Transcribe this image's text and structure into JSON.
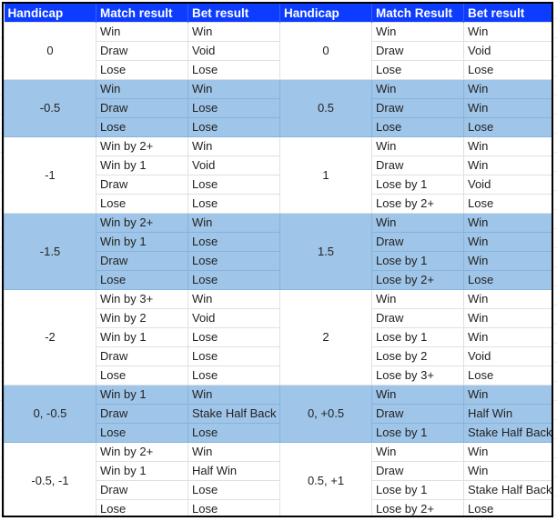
{
  "colors": {
    "header_bg": "#0b3cff",
    "header_text": "#ffffff",
    "band_blue": "#9fc5e8",
    "band_white": "#ffffff"
  },
  "headers": [
    "Handicap",
    "Match result",
    "Bet result",
    "Handicap",
    "Match Result",
    "Bet result"
  ],
  "groups": [
    {
      "shade": "white",
      "left": {
        "handicap": "0",
        "rows": [
          [
            "Win",
            "Win"
          ],
          [
            "Draw",
            "Void"
          ],
          [
            "Lose",
            "Lose"
          ]
        ]
      },
      "right": {
        "handicap": "0",
        "rows": [
          [
            "Win",
            "Win"
          ],
          [
            "Draw",
            "Void"
          ],
          [
            "Lose",
            "Lose"
          ]
        ]
      }
    },
    {
      "shade": "blue",
      "left": {
        "handicap": "-0.5",
        "rows": [
          [
            "Win",
            "Win"
          ],
          [
            "Draw",
            "Lose"
          ],
          [
            "Lose",
            "Lose"
          ]
        ]
      },
      "right": {
        "handicap": "0.5",
        "rows": [
          [
            "Win",
            "Win"
          ],
          [
            "Draw",
            "Win"
          ],
          [
            "Lose",
            "Lose"
          ]
        ]
      }
    },
    {
      "shade": "white",
      "left": {
        "handicap": "-1",
        "rows": [
          [
            "Win by 2+",
            "Win"
          ],
          [
            "Win by 1",
            "Void"
          ],
          [
            "Draw",
            "Lose"
          ],
          [
            "Lose",
            "Lose"
          ]
        ]
      },
      "right": {
        "handicap": "1",
        "rows": [
          [
            "Win",
            "Win"
          ],
          [
            "Draw",
            "Win"
          ],
          [
            "Lose by 1",
            "Void"
          ],
          [
            "Lose by 2+",
            "Lose"
          ]
        ]
      }
    },
    {
      "shade": "blue",
      "left": {
        "handicap": "-1.5",
        "rows": [
          [
            "Win by 2+",
            "Win"
          ],
          [
            "Win by 1",
            "Lose"
          ],
          [
            "Draw",
            "Lose"
          ],
          [
            "Lose",
            "Lose"
          ]
        ]
      },
      "right": {
        "handicap": "1.5",
        "rows": [
          [
            "Win",
            "Win"
          ],
          [
            "Draw",
            "Win"
          ],
          [
            "Lose by 1",
            "Win"
          ],
          [
            "Lose by 2+",
            "Lose"
          ]
        ]
      }
    },
    {
      "shade": "white",
      "left": {
        "handicap": "-2",
        "rows": [
          [
            "Win by 3+",
            "Win"
          ],
          [
            "Win by 2",
            "Void"
          ],
          [
            "Win by 1",
            "Lose"
          ],
          [
            "Draw",
            "Lose"
          ],
          [
            "Lose",
            "Lose"
          ]
        ]
      },
      "right": {
        "handicap": "2",
        "rows": [
          [
            "Win",
            "Win"
          ],
          [
            "Draw",
            "Win"
          ],
          [
            "Lose by 1",
            "Win"
          ],
          [
            "Lose by 2",
            "Void"
          ],
          [
            "Lose by 3+",
            "Lose"
          ]
        ]
      }
    },
    {
      "shade": "blue",
      "left": {
        "handicap": "0, -0.5",
        "rows": [
          [
            "Win by 1",
            "Win"
          ],
          [
            "Draw",
            "Stake Half Back"
          ],
          [
            "Lose",
            "Lose"
          ]
        ]
      },
      "right": {
        "handicap": "0, +0.5",
        "rows": [
          [
            "Win",
            "Win"
          ],
          [
            "Draw",
            "Half Win"
          ],
          [
            "Lose by 1",
            "Stake Half Back"
          ]
        ]
      }
    },
    {
      "shade": "white",
      "left": {
        "handicap": "-0.5, -1",
        "rows": [
          [
            "Win by 2+",
            "Win"
          ],
          [
            "Win by 1",
            "Half Win"
          ],
          [
            "Draw",
            "Lose"
          ],
          [
            "Lose",
            "Lose"
          ]
        ]
      },
      "right": {
        "handicap": "0.5, +1",
        "rows": [
          [
            "Win",
            "Win"
          ],
          [
            "Draw",
            "Win"
          ],
          [
            "Lose by 1",
            "Stake Half Back"
          ],
          [
            "Lose by 2+",
            "Lose"
          ]
        ]
      }
    }
  ]
}
